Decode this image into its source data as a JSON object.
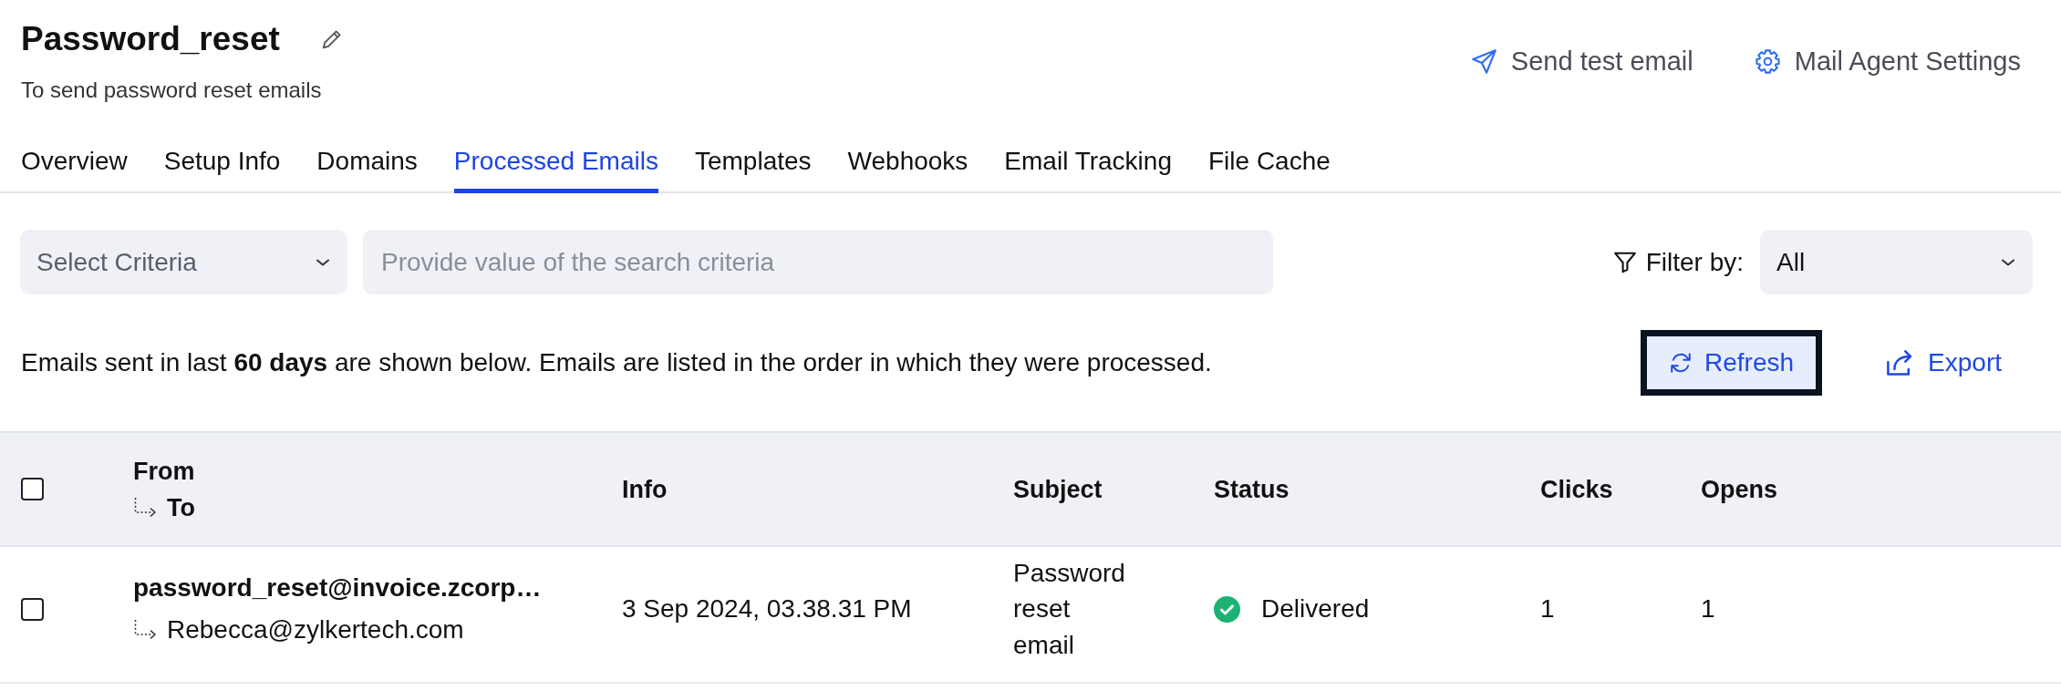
{
  "header": {
    "title": "Password_reset",
    "description": "To send password reset emails",
    "actions": [
      {
        "kind": "send",
        "label": "Send test email"
      },
      {
        "kind": "settings",
        "label": "Mail Agent Settings"
      }
    ]
  },
  "tabs": [
    {
      "label": "Overview",
      "selected": false
    },
    {
      "label": "Setup Info",
      "selected": false
    },
    {
      "label": "Domains",
      "selected": false
    },
    {
      "label": "Processed Emails",
      "selected": true
    },
    {
      "label": "Templates",
      "selected": false
    },
    {
      "label": "Webhooks",
      "selected": false
    },
    {
      "label": "Email Tracking",
      "selected": false
    },
    {
      "label": "File Cache",
      "selected": false
    }
  ],
  "search": {
    "criteria": {
      "placeholder": "Select Criteria"
    },
    "query": {
      "placeholder": "Provide value of the search criteria"
    },
    "filter": {
      "label": "Filter by:",
      "value": "All"
    }
  },
  "notice": "Emails sent in last **60 days** are shown below. Emails are listed in the order in which they were processed.",
  "toolbar": [
    {
      "kind": "refresh",
      "label": "Refresh",
      "focused": true
    },
    {
      "kind": "export",
      "label": "Export",
      "focused": false
    }
  ],
  "table": {
    "select_all": {
      "checked": false
    },
    "columns": [
      {
        "label": "From",
        "sublabel": "To"
      },
      {
        "label": "Info"
      },
      {
        "label": "Subject"
      },
      {
        "label": "Status"
      },
      {
        "label": "Clicks"
      },
      {
        "label": "Opens"
      }
    ],
    "rows": [
      {
        "checked": false,
        "from": "password_reset@invoice.zcorp…",
        "to": "Rebecca@zylkertech.com",
        "info": "3 Sep 2024, 03.38.31 PM",
        "subject": "Password reset email",
        "status": {
          "kind": "delivered",
          "label": "Delivered"
        },
        "clicks": "1",
        "opens": "1"
      }
    ]
  }
}
